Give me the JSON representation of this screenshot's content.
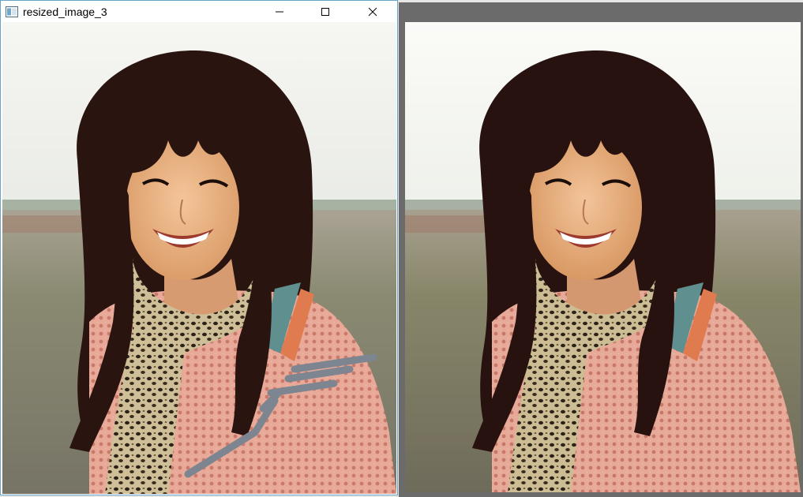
{
  "window": {
    "title": "resized_image_3",
    "controls": {
      "minimize": "minimize-icon",
      "maximize": "maximize-icon",
      "close": "close-icon"
    }
  },
  "images": {
    "left": {
      "description_icon": "photo",
      "has_inpaint_mask_stroke": true
    },
    "right": {
      "description_icon": "photo"
    }
  },
  "colors": {
    "window_border": "#6aa3c8",
    "frame_dark": "#6b6b6b",
    "mask_stroke": "#7d8590"
  }
}
